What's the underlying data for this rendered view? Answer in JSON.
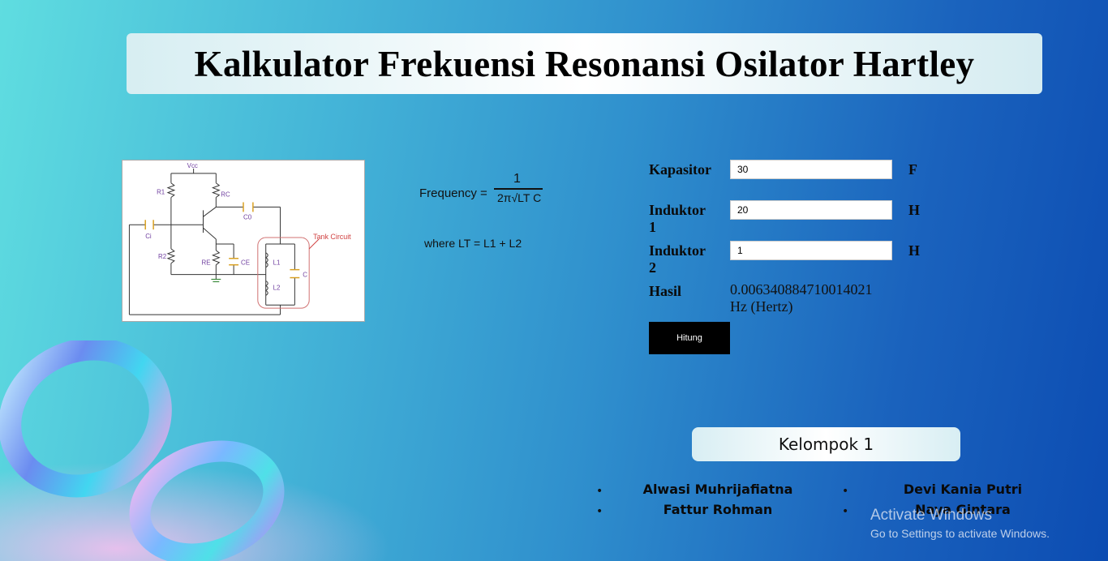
{
  "header": {
    "title": "Kalkulator Frekuensi Resonansi Osilator Hartley"
  },
  "circuit": {
    "labels": {
      "vcc": "Vcc",
      "r1": "R1",
      "rc": "RC",
      "c0": "C0",
      "ci": "Ci",
      "r2": "R2",
      "re": "RE",
      "ce": "CE",
      "l1": "L1",
      "l2": "L2",
      "c": "C",
      "tank": "Tank Circuit"
    }
  },
  "formula": {
    "frequency_label": "Frequency =",
    "numerator": "1",
    "denominator": "2π√LT C",
    "where_line": "where  LT = L1 + L2"
  },
  "form": {
    "kapasitor": {
      "label": "Kapasitor",
      "value": "30",
      "unit": "F"
    },
    "induktor1": {
      "label": "Induktor 1",
      "value": "20",
      "unit": "H"
    },
    "induktor2": {
      "label": "Induktor 2",
      "value": "1",
      "unit": "H"
    },
    "hasil": {
      "label": "Hasil",
      "value": "0.006340884710014021 Hz (Hertz)"
    },
    "button_label": "Hitung"
  },
  "group": {
    "title": "Kelompok 1",
    "members": [
      "Alwasi Muhrijafiatna",
      "Devi Kania Putri",
      "Fattur Rohman",
      "Naya Gintara"
    ],
    "bullet": "•"
  },
  "watermark": {
    "line1": "Activate Windows",
    "line2": "Go to Settings to activate Windows."
  },
  "colors": {
    "accent_orange": "#e0a020",
    "tank_red": "#d04040",
    "button_bg": "#000000"
  }
}
